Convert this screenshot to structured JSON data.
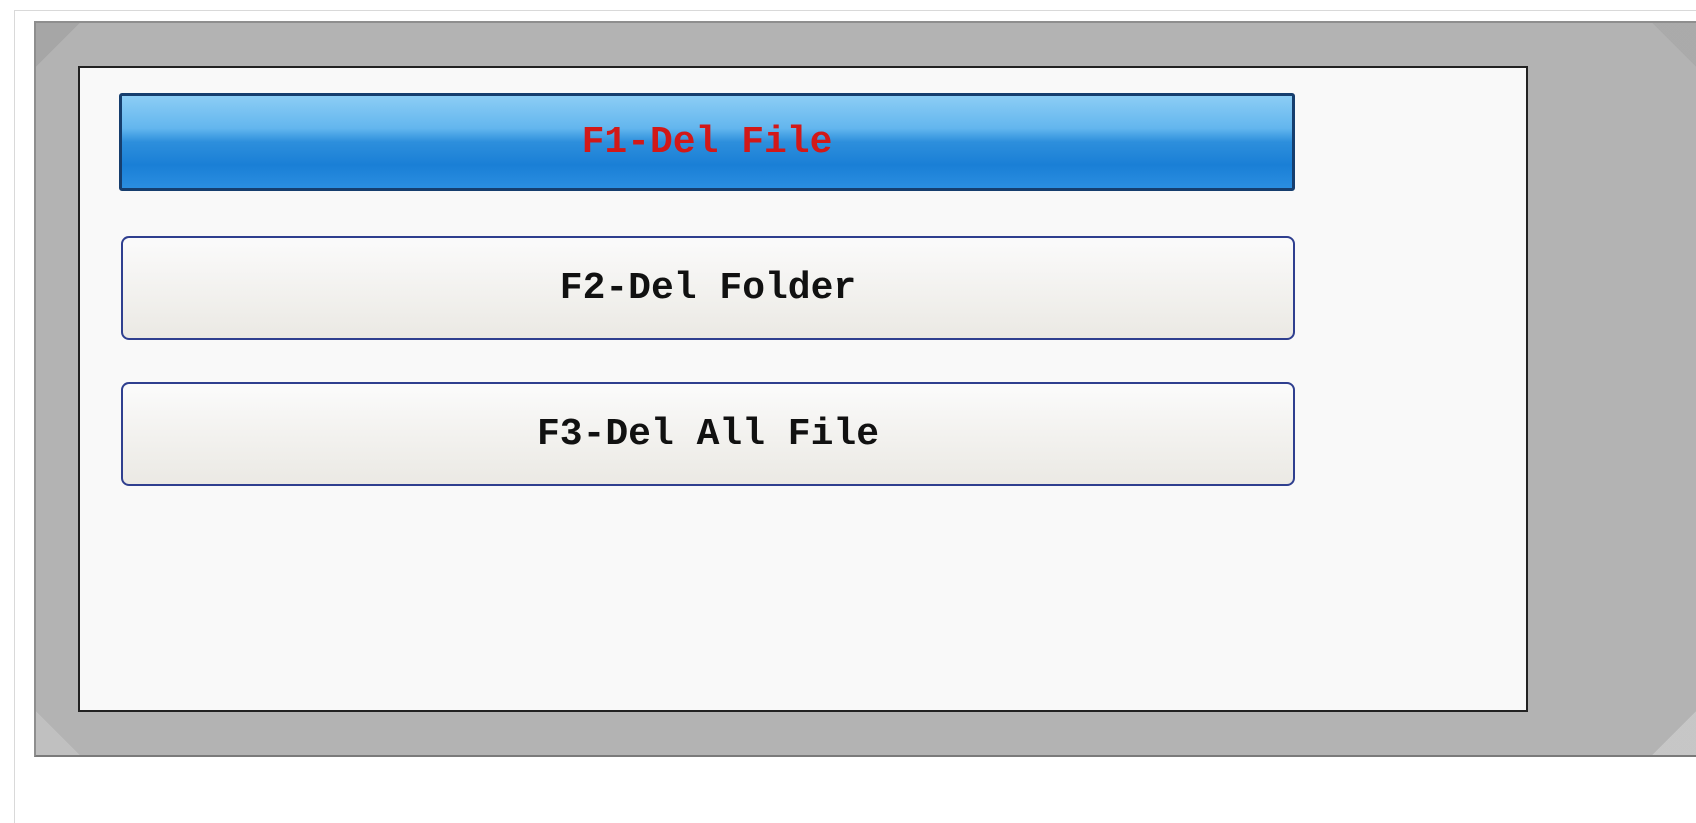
{
  "menu": {
    "items": [
      {
        "label": "F1-Del File",
        "selected": true
      },
      {
        "label": "F2-Del Folder",
        "selected": false
      },
      {
        "label": "F3-Del All File",
        "selected": false
      }
    ]
  },
  "colors": {
    "selected_background": "#2d8fdc",
    "selected_text": "#d21818",
    "normal_text": "#111111",
    "frame": "#b3b3b3",
    "panel": "#f9f9f9"
  }
}
